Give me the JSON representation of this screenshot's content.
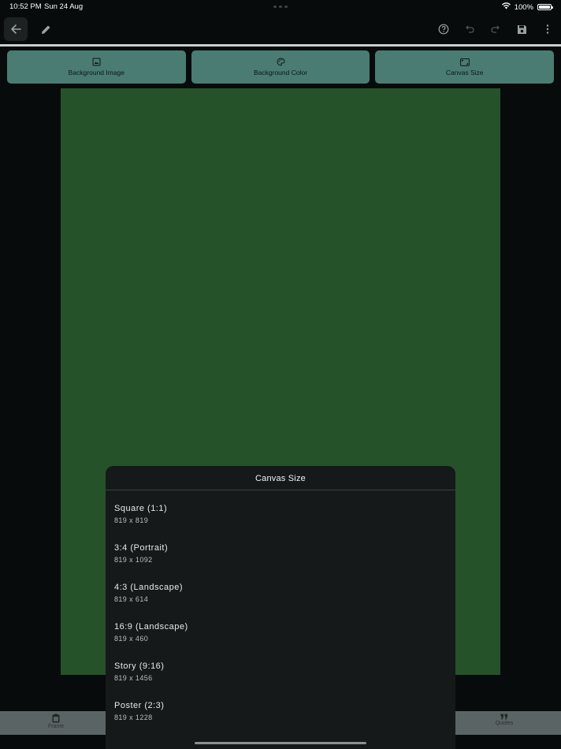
{
  "status": {
    "time": "10:52 PM",
    "date": "Sun 24 Aug",
    "battery": "100%",
    "battery_level": 1.0
  },
  "toolbar": {
    "icons": [
      "back-arrow-icon",
      "pencil-icon",
      "help-icon",
      "undo-icon",
      "redo-icon",
      "save-icon",
      "more-vertical-icon"
    ]
  },
  "tabs": [
    {
      "label": "Background Image",
      "icon": "image-icon"
    },
    {
      "label": "Background Color",
      "icon": "palette-icon"
    },
    {
      "label": "Canvas Size",
      "icon": "aspect-ratio-icon"
    }
  ],
  "canvas": {
    "color": "#26522a"
  },
  "bottom_nav": [
    {
      "label": "Frame",
      "icon": "clipboard-icon"
    },
    {
      "label": "Quotes",
      "icon": "quote-icon"
    }
  ],
  "sheet": {
    "title": "Canvas Size",
    "items": [
      {
        "name": "Square (1:1)",
        "dims": "819 x 819"
      },
      {
        "name": "3:4 (Portrait)",
        "dims": "819 x 1092"
      },
      {
        "name": "4:3 (Landscape)",
        "dims": "819 x 614"
      },
      {
        "name": "16:9 (Landscape)",
        "dims": "819 x 460"
      },
      {
        "name": "Story (9:16)",
        "dims": "819 x 1456"
      },
      {
        "name": "Poster (2:3)",
        "dims": "819 x 1228"
      }
    ]
  },
  "colors": {
    "accent": "#4a7c73",
    "background": "#070b0b",
    "sheet": "#151919"
  }
}
